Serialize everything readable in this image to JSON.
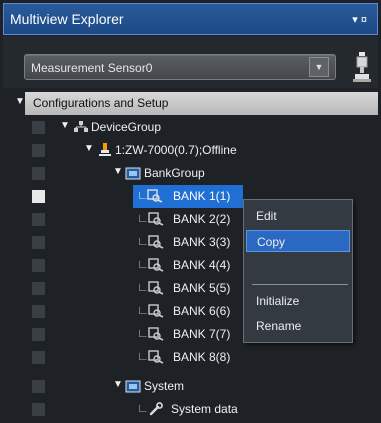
{
  "window": {
    "title": "Multiview Explorer",
    "pin_glyph": "▾ ¤"
  },
  "sensor": {
    "value": "Measurement Sensor0"
  },
  "tree": {
    "root_label": "Configurations and Setup",
    "device_group": "DeviceGroup",
    "device": "1:ZW-7000(0.7);Offline",
    "bank_group": "BankGroup",
    "banks": [
      "BANK 1(1)",
      "BANK 2(2)",
      "BANK 3(3)",
      "BANK 4(4)",
      "BANK 5(5)",
      "BANK 6(6)",
      "BANK 7(7)",
      "BANK 8(8)"
    ],
    "system": "System",
    "system_data": "System data"
  },
  "context_menu": {
    "items": [
      "Edit",
      "Copy",
      "Initialize",
      "Rename"
    ],
    "highlighted": "Copy"
  },
  "colors": {
    "title_bar": "#1c4a86",
    "panel_bg": "#1e2226",
    "selection": "#1f6fd4",
    "menu_bg": "#343a42"
  }
}
